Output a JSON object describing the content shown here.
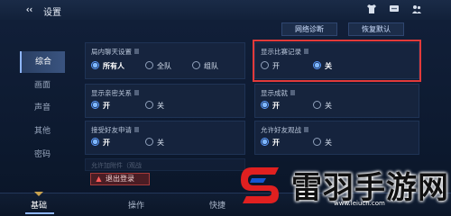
{
  "header": {
    "title": "设置",
    "icons": [
      "shirt-icon",
      "chat-icon",
      "friends-icon"
    ]
  },
  "top_actions": {
    "network_diag": "网络诊断",
    "restore_default": "恢复默认"
  },
  "sidebar": {
    "items": [
      {
        "label": "综合",
        "active": true
      },
      {
        "label": "画面",
        "active": false
      },
      {
        "label": "声音",
        "active": false
      },
      {
        "label": "其他",
        "active": false
      },
      {
        "label": "密码",
        "active": false
      }
    ]
  },
  "panels": {
    "lobby_chat": {
      "title": "局内聊天设置",
      "options": [
        {
          "label": "所有人",
          "selected": true
        },
        {
          "label": "全队",
          "selected": false
        },
        {
          "label": "组队",
          "selected": false
        }
      ]
    },
    "show_match_record": {
      "title": "显示比赛记录",
      "options": [
        {
          "label": "开",
          "selected": false
        },
        {
          "label": "关",
          "selected": true
        }
      ]
    },
    "show_intimacy": {
      "title": "显示亲密关系",
      "options": [
        {
          "label": "开",
          "selected": true
        },
        {
          "label": "关",
          "selected": false
        }
      ]
    },
    "show_achievement": {
      "title": "显示成就",
      "options": [
        {
          "label": "开",
          "selected": true
        },
        {
          "label": "关",
          "selected": false
        }
      ]
    },
    "accept_friend_request": {
      "title": "接受好友申请",
      "options": [
        {
          "label": "开",
          "selected": true
        },
        {
          "label": "关",
          "selected": false
        }
      ]
    },
    "allow_friend_watch": {
      "title": "允许好友观战",
      "options": [
        {
          "label": "开",
          "selected": true
        },
        {
          "label": "关",
          "selected": false
        }
      ]
    },
    "partial_title": "允许加附件（观战"
  },
  "logout_label": "退出登录",
  "bottom_tabs": [
    {
      "label": "基础",
      "active": true
    },
    {
      "label": "操作",
      "active": false
    },
    {
      "label": "快捷",
      "active": false
    }
  ],
  "watermark": {
    "brand": "雷羽手游网",
    "url": "www.leiucn.com"
  },
  "colors": {
    "highlight": "#e23a3a",
    "accent": "#5b9bff"
  }
}
